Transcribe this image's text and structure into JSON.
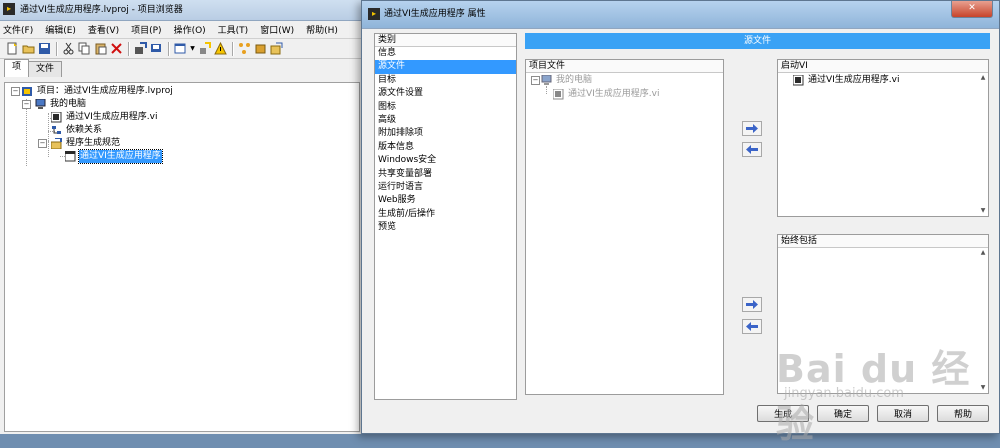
{
  "project_window": {
    "title": "通过VI生成应用程序.lvproj - 项目浏览器",
    "menu": [
      "文件(F)",
      "编辑(E)",
      "查看(V)",
      "项目(P)",
      "操作(O)",
      "工具(T)",
      "窗口(W)",
      "帮助(H)"
    ],
    "tabs": [
      "项",
      "文件"
    ],
    "tree": {
      "root": "项目：通过VI生成应用程序.lvproj",
      "my_computer": "我的电脑",
      "vi_file": "通过VI生成应用程序.vi",
      "dependencies": "依赖关系",
      "build_specs": "程序生成规范",
      "app_build": "通过VI生成应用程序"
    }
  },
  "dialog": {
    "title": "通过VI生成应用程序 属性",
    "category_header": "类别",
    "categories": [
      "信息",
      "源文件",
      "目标",
      "源文件设置",
      "图标",
      "高级",
      "附加排除项",
      "版本信息",
      "Windows安全",
      "共享变量部署",
      "运行时语言",
      "Web服务",
      "生成前/后操作",
      "预览"
    ],
    "selected_category_index": 1,
    "banner": "源文件",
    "project_files": {
      "header": "项目文件",
      "my_computer": "我的电脑",
      "vi_file": "通过VI生成应用程序.vi"
    },
    "startup_vi": {
      "header": "启动VI",
      "item": "通过VI生成应用程序.vi"
    },
    "always_include": {
      "header": "始终包括"
    },
    "buttons": {
      "build": "生成",
      "ok": "确定",
      "cancel": "取消",
      "help": "帮助"
    },
    "window_buttons": {
      "close_icon_text": "✕"
    }
  },
  "watermark": {
    "brand": "Bai du 经验",
    "url": "jingyan.baidu.com"
  },
  "colors": {
    "selection": "#3399ff",
    "banner": "#3aa2f5",
    "arrow": "#3b64c8"
  }
}
